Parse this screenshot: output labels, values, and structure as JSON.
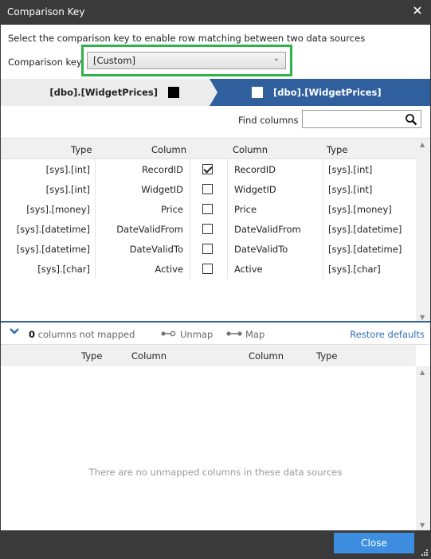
{
  "window": {
    "title": "Comparison Key"
  },
  "instruction": "Select the comparison key to enable row matching between two data sources",
  "comparison_key": {
    "label": "Comparison key:",
    "value": "[Custom]"
  },
  "sources": {
    "left": "[dbo].[WidgetPrices]",
    "right": "[dbo].[WidgetPrices]"
  },
  "find": {
    "label": "Find columns",
    "value": ""
  },
  "grid": {
    "headers": {
      "type_left": "Type",
      "column_left": "Column",
      "column_right": "Column",
      "type_right": "Type"
    },
    "rows": [
      {
        "type_left": "[sys].[int]",
        "column_left": "RecordID",
        "checked": true,
        "column_right": "RecordID",
        "type_right": "[sys].[int]"
      },
      {
        "type_left": "[sys].[int]",
        "column_left": "WidgetID",
        "checked": false,
        "column_right": "WidgetID",
        "type_right": "[sys].[int]"
      },
      {
        "type_left": "[sys].[money]",
        "column_left": "Price",
        "checked": false,
        "column_right": "Price",
        "type_right": "[sys].[money]"
      },
      {
        "type_left": "[sys].[datetime]",
        "column_left": "DateValidFrom",
        "checked": false,
        "column_right": "DateValidFrom",
        "type_right": "[sys].[datetime]"
      },
      {
        "type_left": "[sys].[datetime]",
        "column_left": "DateValidTo",
        "checked": false,
        "column_right": "DateValidTo",
        "type_right": "[sys].[datetime]"
      },
      {
        "type_left": "[sys].[char]",
        "column_left": "Active",
        "checked": false,
        "column_right": "Active",
        "type_right": "[sys].[char]"
      }
    ]
  },
  "unmapped": {
    "count": "0",
    "count_suffix": " columns not mapped",
    "unmap_label": "Unmap",
    "map_label": "Map",
    "restore_label": "Restore defaults",
    "headers": {
      "type_left": "Type",
      "column_left": "Column",
      "column_right": "Column",
      "type_right": "Type"
    },
    "empty_message": "There are no unmapped columns in these data sources"
  },
  "footer": {
    "close_label": "Close"
  },
  "colors": {
    "accent_blue": "#2f5f9d",
    "highlight_green": "#2db34a",
    "button_blue": "#3d8ee0",
    "link_blue": "#2f6fb5"
  }
}
